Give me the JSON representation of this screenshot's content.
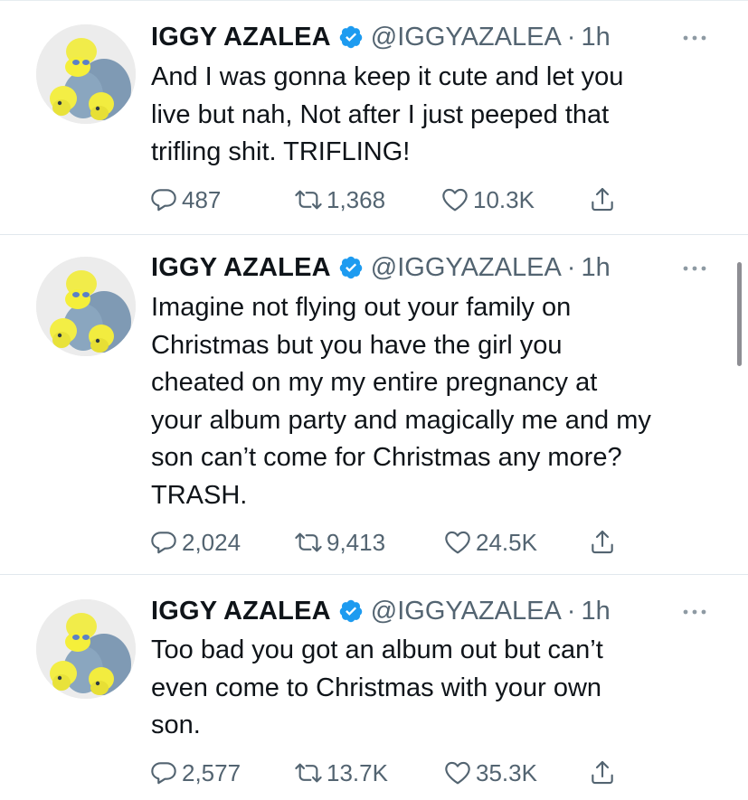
{
  "colors": {
    "verified_blue": "#1d9bf0",
    "text_primary": "#0f1419",
    "text_secondary": "#536471",
    "divider": "#e1e8ed"
  },
  "tweets": [
    {
      "name": "IGGY AZALEA",
      "handle": "@IGGYAZALEA",
      "separator": "·",
      "time": "1h",
      "lines": [
        "And I was gonna keep it cute and let you",
        "live but nah, Not after I just peeped that",
        "trifling shit. TRIFLING!"
      ],
      "replies": "487",
      "retweets": "1,368",
      "likes": "10.3K"
    },
    {
      "name": "IGGY AZALEA",
      "handle": "@IGGYAZALEA",
      "separator": "·",
      "time": "1h",
      "lines": [
        "Imagine not flying out your family on",
        "Christmas but you have the girl you",
        "cheated on my my entire pregnancy at",
        "your album party and magically me and my",
        "son can’t come for Christmas any more?",
        "TRASH."
      ],
      "replies": "2,024",
      "retweets": "9,413",
      "likes": "24.5K"
    },
    {
      "name": "IGGY AZALEA",
      "handle": "@IGGYAZALEA",
      "separator": "·",
      "time": "1h",
      "lines": [
        "Too bad you got an album out but can’t",
        "even come to Christmas with your own",
        "son."
      ],
      "replies": "2,577",
      "retweets": "13.7K",
      "likes": "35.3K"
    }
  ]
}
